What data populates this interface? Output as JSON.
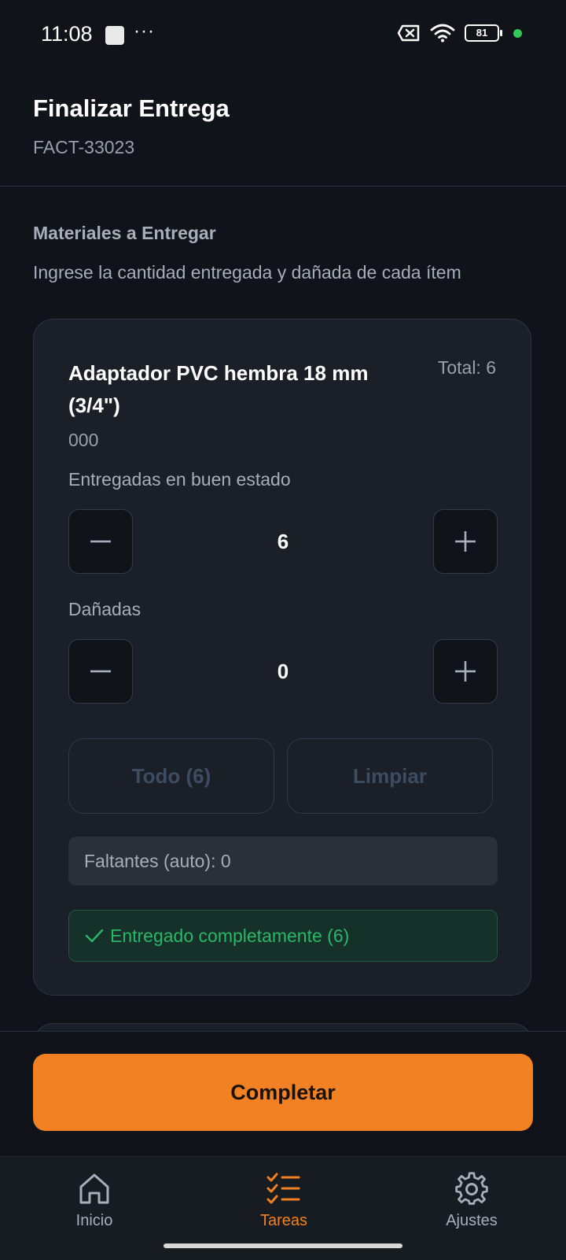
{
  "status_bar": {
    "time": "11:08",
    "dots": "···",
    "battery": "81"
  },
  "header": {
    "title": "Finalizar Entrega",
    "subtitle": "FACT-33023"
  },
  "section": {
    "title": "Materiales a Entregar",
    "description": "Ingrese la cantidad entregada y dañada de cada ítem"
  },
  "item": {
    "name": "Adaptador PVC hembra 18 mm (3/4\")",
    "total": "Total: 6",
    "code": "000",
    "good_label": "Entregadas en buen estado",
    "good_value": "6",
    "damaged_label": "Dañadas",
    "damaged_value": "0",
    "all_button": "Todo (6)",
    "clear_button": "Limpiar",
    "missing": "Faltantes (auto): 0",
    "status": "Entregado completamente (6)"
  },
  "actions": {
    "complete": "Completar"
  },
  "nav": {
    "home": "Inicio",
    "tasks": "Tareas",
    "settings": "Ajustes"
  },
  "colors": {
    "accent": "#f28123",
    "success": "#28b866",
    "background": "#10131a",
    "card": "#1b1f27"
  }
}
